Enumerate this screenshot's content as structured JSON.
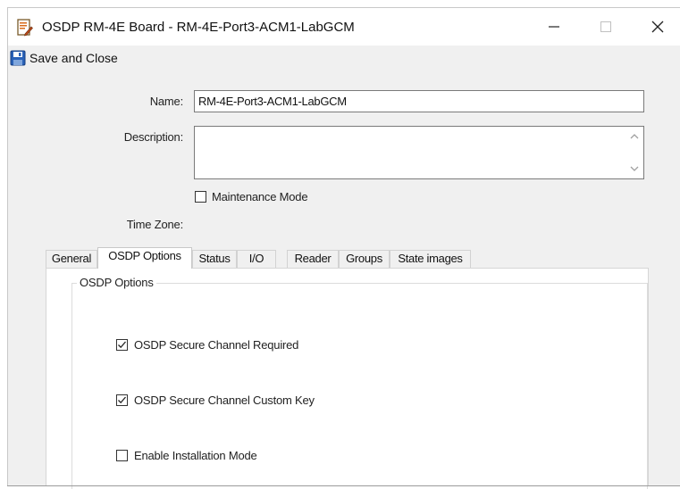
{
  "window": {
    "title": "OSDP RM-4E Board  -  RM-4E-Port3-ACM1-LabGCM"
  },
  "toolbar": {
    "save_label": "Save and Close"
  },
  "form": {
    "name_label": "Name:",
    "name_value": "RM-4E-Port3-ACM1-LabGCM",
    "description_label": "Description:",
    "description_value": "",
    "maintenance_label": "Maintenance Mode",
    "maintenance_checked": false,
    "timezone_label": "Time Zone:"
  },
  "tabs": [
    {
      "label": "General",
      "active": false
    },
    {
      "label": "OSDP Options",
      "active": true
    },
    {
      "label": "Status",
      "active": false
    },
    {
      "label": "I/O",
      "active": false
    },
    {
      "label": "Reader",
      "active": false
    },
    {
      "label": "Groups",
      "active": false
    },
    {
      "label": "State images",
      "active": false
    }
  ],
  "osdp_panel": {
    "group_title": "OSDP Options",
    "options": [
      {
        "label": "OSDP Secure Channel Required",
        "checked": true
      },
      {
        "label": "OSDP Secure Channel Custom Key",
        "checked": true
      },
      {
        "label": "Enable Installation Mode",
        "checked": false
      }
    ]
  },
  "icons": {
    "app": "document-edit-icon",
    "save": "floppy-disk-icon",
    "minimize": "minimize-icon",
    "maximize": "maximize-icon",
    "close": "close-icon"
  },
  "colors": {
    "save_icon": "#2a62b8",
    "window_bg": "#f0f0f0"
  }
}
